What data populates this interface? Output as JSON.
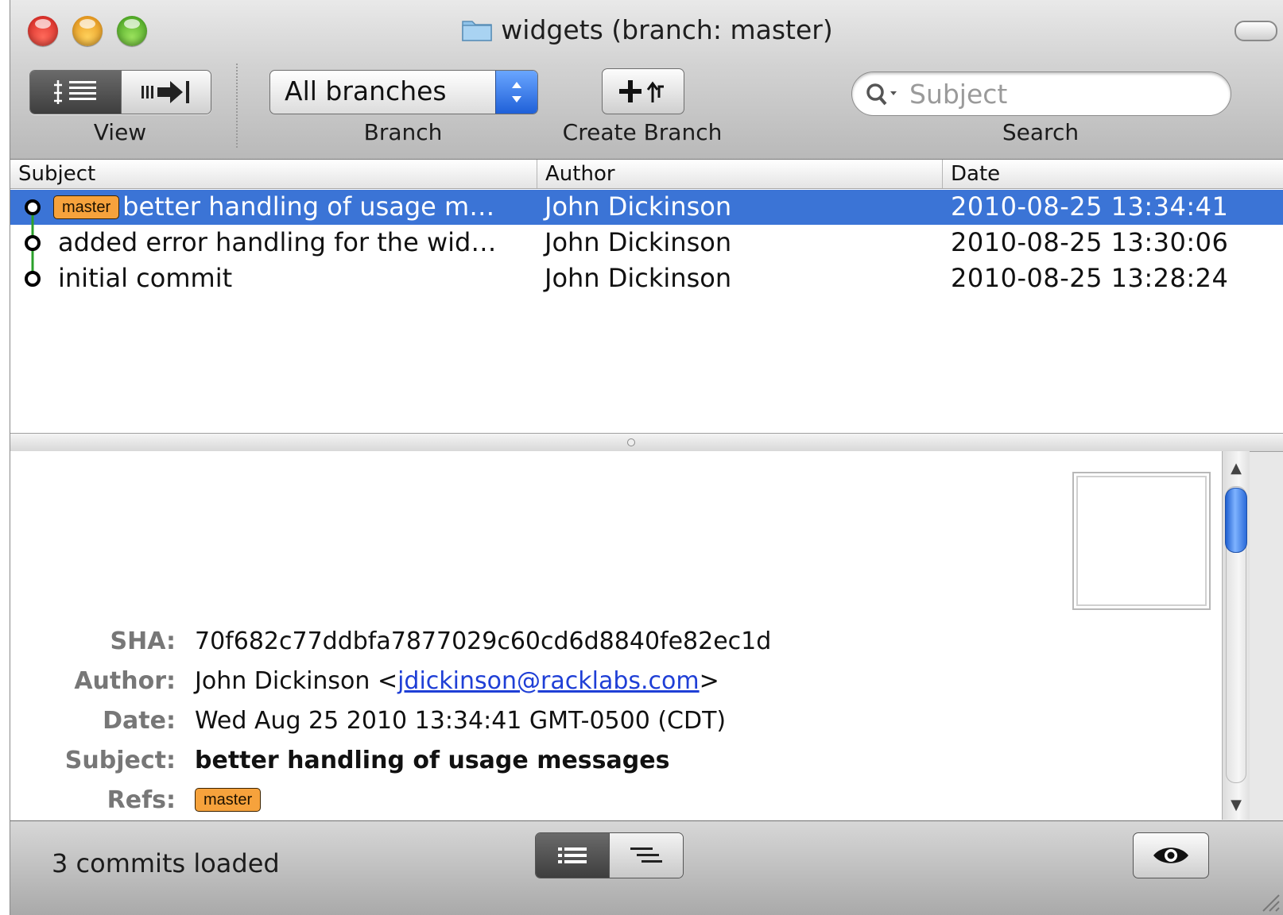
{
  "window": {
    "title": "widgets (branch: master)"
  },
  "toolbar": {
    "view_label": "View",
    "branch_label": "Branch",
    "branch_value": "All branches",
    "create_branch_label": "Create Branch",
    "search_label": "Search",
    "search_placeholder": "Subject"
  },
  "table": {
    "columns": [
      "Subject",
      "Author",
      "Date"
    ],
    "rows": [
      {
        "ref": "master",
        "subject": "better handling of usage m…",
        "author": "John Dickinson",
        "date": "2010-08-25 13:34:41",
        "selected": true
      },
      {
        "subject": "added error handling for the wid…",
        "author": "John Dickinson",
        "date": "2010-08-25 13:30:06"
      },
      {
        "subject": "initial commit",
        "author": "John Dickinson",
        "date": "2010-08-25 13:28:24"
      }
    ]
  },
  "details": {
    "sha_label": "SHA:",
    "sha": "70f682c77ddbfa7877029c60cd6d8840fe82ec1d",
    "author_label": "Author:",
    "author_name": "John Dickinson <",
    "author_email": "jdickinson@racklabs.com",
    "author_close": ">",
    "date_label": "Date:",
    "date": "Wed Aug 25 2010 13:34:41 GMT-0500 (CDT)",
    "subject_label": "Subject:",
    "subject": "better handling of usage messages",
    "refs_label": "Refs:",
    "refs": [
      "master"
    ]
  },
  "status": {
    "text": "3 commits loaded"
  },
  "colors": {
    "selection": "#3b74d6",
    "ref_badge": "#f6a23c",
    "graph_line": "#2aa02a",
    "link": "#1f3fd6"
  }
}
